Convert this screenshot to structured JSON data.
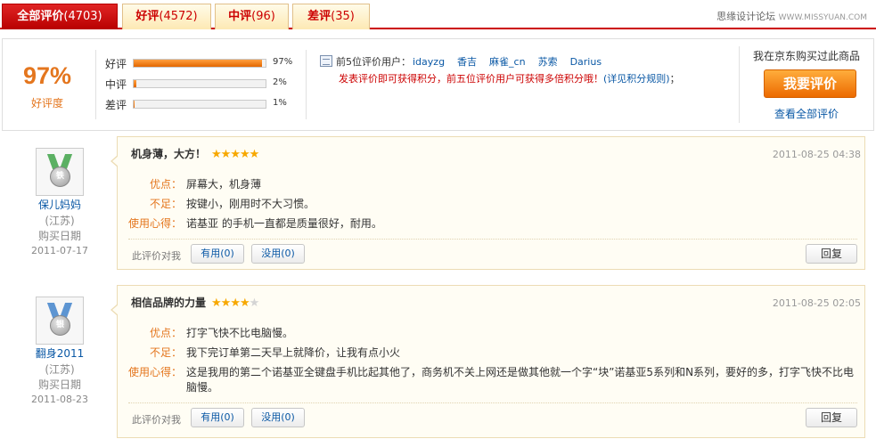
{
  "tabs": [
    {
      "label": "全部评价",
      "count": "(4703)"
    },
    {
      "label": "好评",
      "count": "(4572)"
    },
    {
      "label": "中评",
      "count": "(96)"
    },
    {
      "label": "差评",
      "count": "(35)"
    }
  ],
  "brand": {
    "name": "思缘设计论坛",
    "url": "WWW.MISSYUAN.COM"
  },
  "summary": {
    "rate": "97%",
    "rate_label": "好评度",
    "bars": [
      {
        "label": "好评",
        "percent": 97,
        "percent_text": "97%"
      },
      {
        "label": "中评",
        "percent": 2,
        "percent_text": "2%"
      },
      {
        "label": "差评",
        "percent": 1,
        "percent_text": "1%"
      }
    ],
    "top5_label": "前5位评价用户：",
    "top5_users": [
      "idayzg",
      "香吉",
      "麻雀_cn",
      "苏索",
      "Darius"
    ],
    "points_notice": "发表评价即可获得积分，前五位评价用户可获得多倍积分哦！",
    "points_rules": "(详见积分规则)",
    "points_end": "；",
    "bought_text": "我在京东购买过此商品",
    "write_review": "我要评价",
    "view_all": "查看全部评价"
  },
  "reviews": [
    {
      "user": "保儿妈妈",
      "medal_text": "铁",
      "location": "(江苏)",
      "purchase_label": "购买日期",
      "purchase_date": "2011-07-17",
      "title": "机身薄，大方！",
      "rating": 5,
      "time": "2011-08-25 04:38",
      "pros_label": "优点：",
      "pros": "屏幕大，机身薄",
      "cons_label": "不足：",
      "cons": "按键小，刚用时不大习惯。",
      "exp_label": "使用心得：",
      "exp": "诺基亚 的手机一直都是质量很好，耐用。",
      "helpful_q": "此评价对我",
      "useful": "有用(0)",
      "useless": "没用(0)",
      "reply": "回复"
    },
    {
      "user": "翻身2011",
      "medal_text": "银",
      "location": "(江苏)",
      "purchase_label": "购买日期",
      "purchase_date": "2011-08-23",
      "title": "相信品牌的力量",
      "rating": 4,
      "time": "2011-08-25 02:05",
      "pros_label": "优点：",
      "pros": "打字飞快不比电脑慢。",
      "cons_label": "不足：",
      "cons": "我下完订单第二天早上就降价，让我有点小火",
      "exp_label": "使用心得：",
      "exp": "这是我用的第二个诺基亚全键盘手机比起其他了，商务机不关上网还是做其他就一个字“块”诺基亚5系列和N系列，要好的多，打字飞快不比电脑慢。",
      "helpful_q": "此评价对我",
      "useful": "有用(0)",
      "useless": "没用(0)",
      "reply": "回复"
    }
  ]
}
